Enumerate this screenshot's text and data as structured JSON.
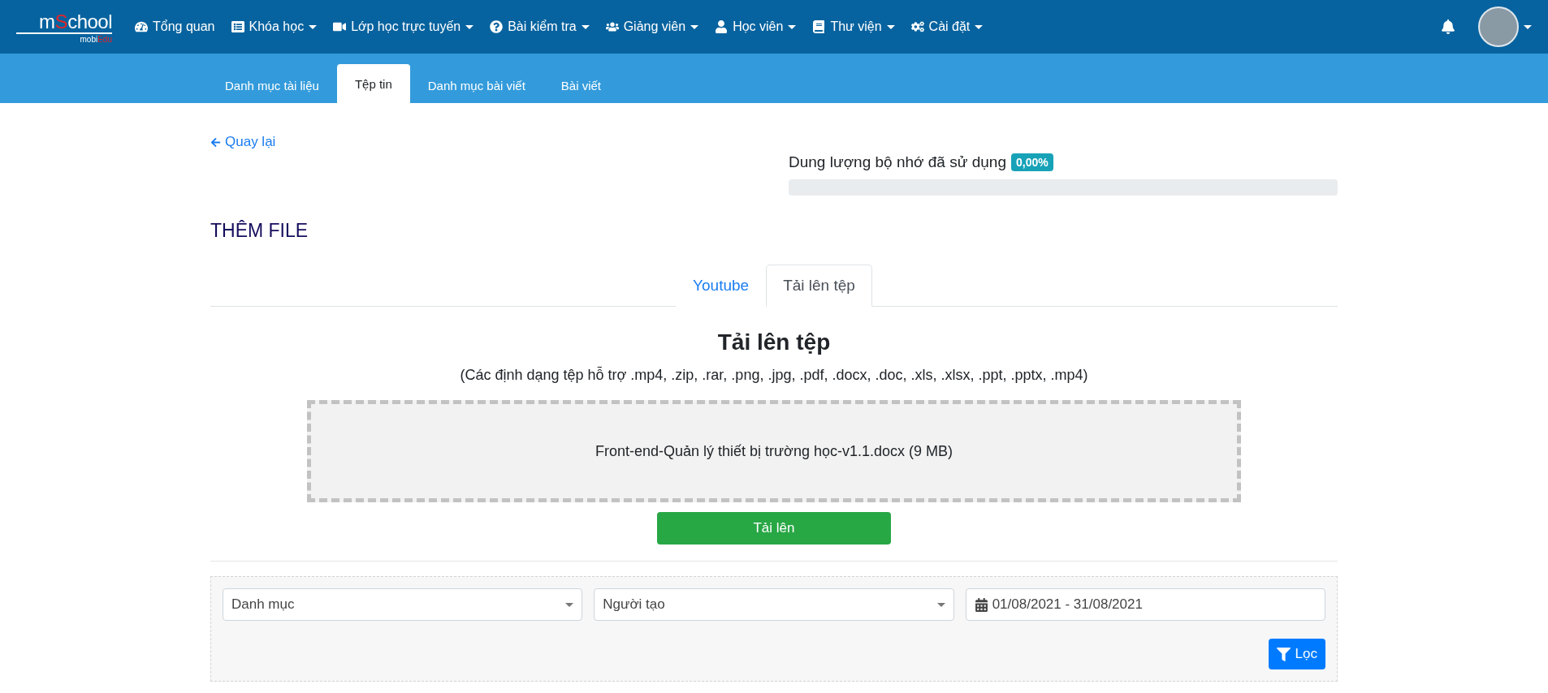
{
  "logo": {
    "title": [
      "m",
      "S",
      "chool"
    ],
    "subtitle": [
      "mobi",
      "Edu"
    ]
  },
  "nav": [
    {
      "label": "Tổng quan",
      "has_menu": false
    },
    {
      "label": "Khóa học",
      "has_menu": true
    },
    {
      "label": "Lớp học trực tuyến",
      "has_menu": true
    },
    {
      "label": "Bài kiểm tra",
      "has_menu": true
    },
    {
      "label": "Giảng viên",
      "has_menu": true
    },
    {
      "label": "Học viên",
      "has_menu": true
    },
    {
      "label": "Thư viện",
      "has_menu": true
    },
    {
      "label": "Cài đặt",
      "has_menu": true
    }
  ],
  "subnav": [
    {
      "label": "Danh mục tài liệu",
      "selected": false
    },
    {
      "label": "Tệp tin",
      "selected": true
    },
    {
      "label": "Danh mục bài viết",
      "selected": false
    },
    {
      "label": "Bài viết",
      "selected": false
    }
  ],
  "back_link": "Quay lại",
  "storage": {
    "label": "Dung lượng bộ nhớ đã sử dụng",
    "badge": "0,00%",
    "level": 0
  },
  "title": "THÊM FILE",
  "upload_tabs": [
    {
      "label": "Youtube",
      "selected": false
    },
    {
      "label": "Tải lên tệp",
      "selected": true
    }
  ],
  "upload": {
    "heading": "Tải lên tệp",
    "formats": "(Các định dạng tệp hỗ trợ .mp4, .zip, .rar, .png, .jpg, .pdf, .docx, .doc, .xls, .xlsx, .ppt, .pptx, .mp4)",
    "file": "Front-end-Quản lý thiết bị trường học-v1.1.docx (9 MB)",
    "button": "Tải lên"
  },
  "filters": {
    "category": "Danh mục",
    "creator": "Người tạo",
    "date_range": "01/08/2021 - 31/08/2021",
    "button": "Lọc"
  }
}
